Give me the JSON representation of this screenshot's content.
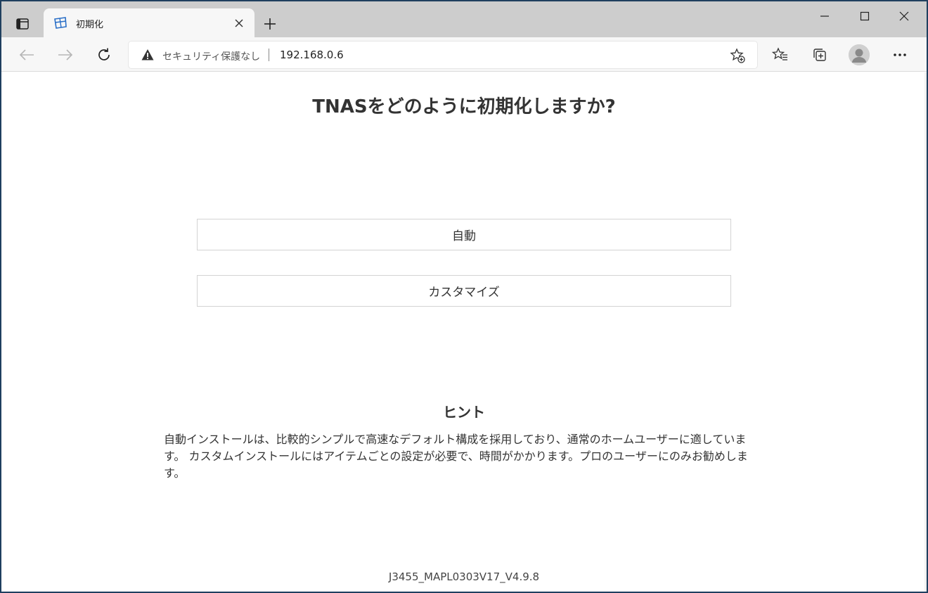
{
  "browser": {
    "tab": {
      "title": "初期化"
    },
    "address": {
      "security_label": "セキュリティ保護なし",
      "url": "192.168.0.6"
    }
  },
  "page": {
    "title": "TNASをどのように初期化しますか?",
    "buttons": {
      "auto": "自動",
      "custom": "カスタマイズ"
    },
    "hint": {
      "title": "ヒント",
      "body": "自動インストールは、比較的シンプルで高速なデフォルト構成を採用しており、通常のホームユーザーに適しています。 カスタムインストールにはアイテムごとの設定が必要で、時間がかかります。プロのユーザーにのみお勧めします。"
    },
    "version": "J3455_MAPL0303V17_V4.9.8"
  },
  "icons": {
    "tab_actions": "tab-actions-icon",
    "favicon": "tnas-favicon-icon",
    "close": "close-icon",
    "new_tab": "plus-icon",
    "minimize": "minimize-icon",
    "maximize": "maximize-icon",
    "window_close": "window-close-icon",
    "back": "back-arrow-icon",
    "forward": "forward-arrow-icon",
    "refresh": "refresh-icon",
    "warning": "warning-icon",
    "add_favorite": "star-plus-icon",
    "favorites": "favorites-icon",
    "collections": "collections-icon",
    "profile": "profile-icon",
    "more": "more-icon"
  }
}
